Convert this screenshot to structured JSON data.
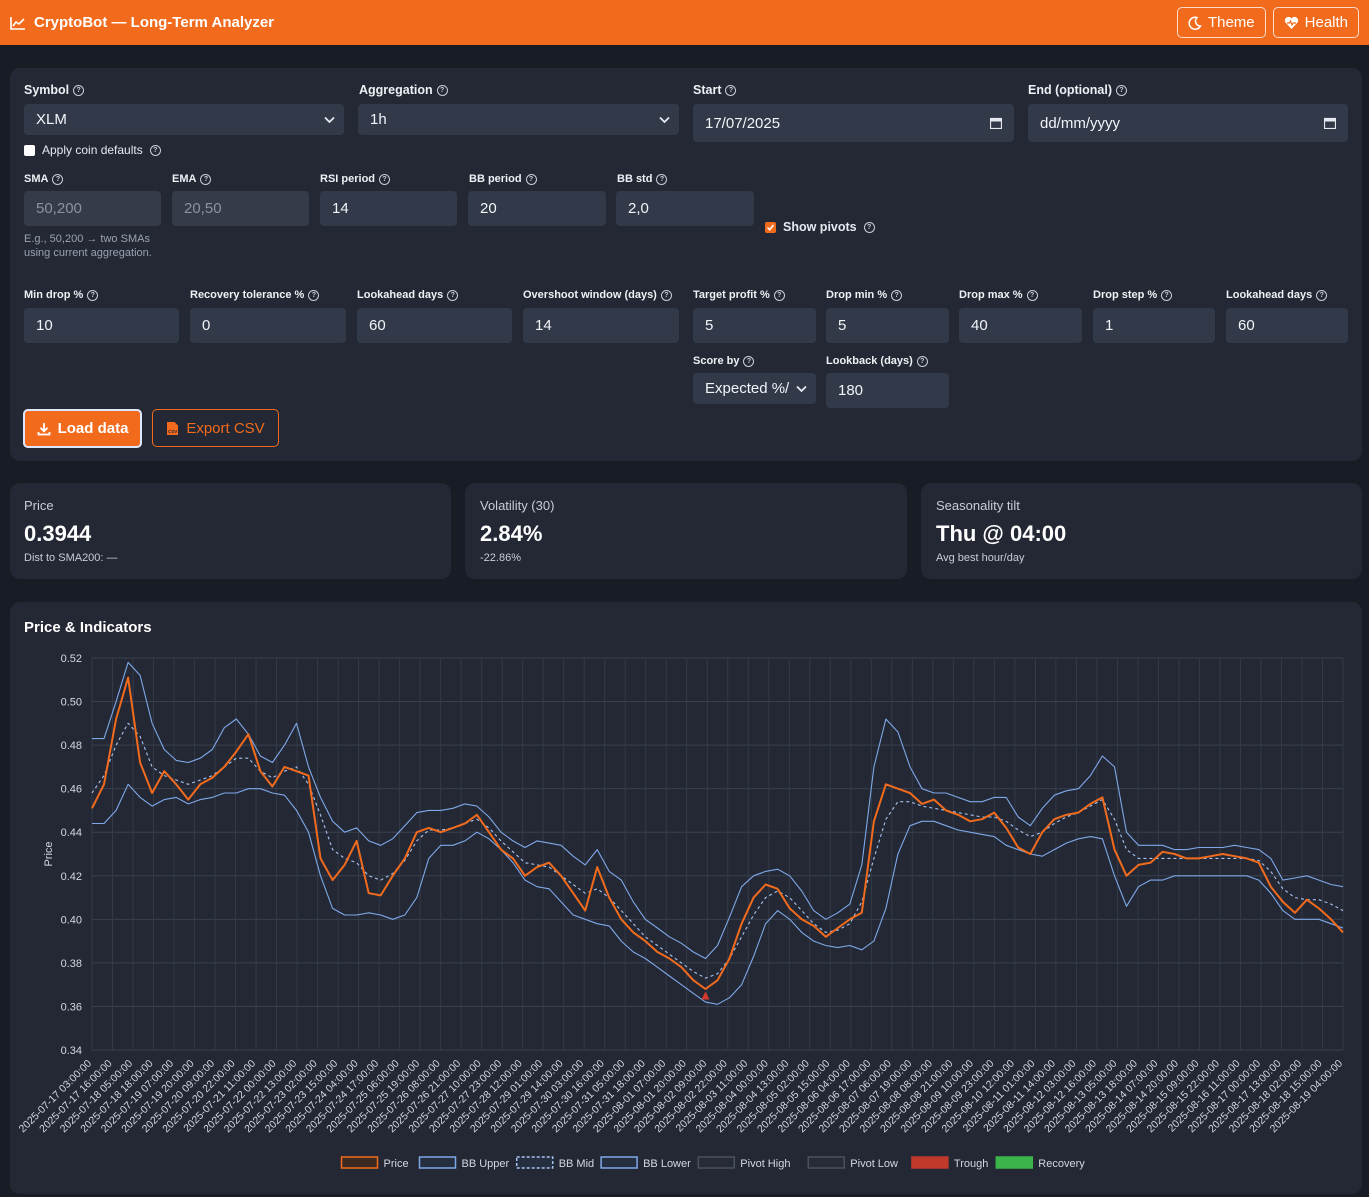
{
  "app": {
    "title": "CryptoBot — Long-Term Analyzer",
    "theme_label": "Theme",
    "health_label": "Health",
    "accent": "#f26b1d"
  },
  "controls": {
    "symbol": {
      "label": "Symbol",
      "value": "XLM"
    },
    "aggregation": {
      "label": "Aggregation",
      "value": "1h"
    },
    "start": {
      "label": "Start",
      "value": "17/07/2025"
    },
    "end": {
      "label": "End (optional)",
      "value": "dd/mm/yyyy"
    },
    "apply_defaults": {
      "label": "Apply coin defaults",
      "checked": false
    },
    "sma": {
      "label": "SMA",
      "value": "50,200",
      "hint": "E.g., 50,200 → two SMAs using current aggregation."
    },
    "ema": {
      "label": "EMA",
      "value": "20,50"
    },
    "rsi": {
      "label": "RSI period",
      "value": "14"
    },
    "bb_period": {
      "label": "BB period",
      "value": "20"
    },
    "bb_std": {
      "label": "BB std",
      "value": "2,0"
    },
    "show_pivots": {
      "label": "Show pivots",
      "checked": true
    },
    "min_drop": {
      "label": "Min drop %",
      "value": "10"
    },
    "recovery_tol": {
      "label": "Recovery tolerance %",
      "value": "0"
    },
    "lookahead_left": {
      "label": "Lookahead days",
      "value": "60"
    },
    "overshoot": {
      "label": "Overshoot window (days)",
      "value": "14"
    },
    "target_profit": {
      "label": "Target profit %",
      "value": "5"
    },
    "drop_min": {
      "label": "Drop min %",
      "value": "5"
    },
    "drop_max": {
      "label": "Drop max %",
      "value": "40"
    },
    "drop_step": {
      "label": "Drop step %",
      "value": "1"
    },
    "lookahead_right": {
      "label": "Lookahead days",
      "value": "60"
    },
    "score_by": {
      "label": "Score by",
      "value": "Expected %/"
    },
    "lookback": {
      "label": "Lookback (days)",
      "value": "180"
    },
    "load_label": "Load data",
    "export_label": "Export CSV"
  },
  "stats": [
    {
      "label": "Price",
      "value": "0.3944",
      "sub": "Dist to SMA200: —"
    },
    {
      "label": "Volatility (30)",
      "value": "2.84%",
      "sub": "-22.86%"
    },
    {
      "label": "Seasonality tilt",
      "value": "Thu @ 04:00",
      "sub": "Avg best hour/day"
    }
  ],
  "chart_panel_title": "Price & Indicators",
  "chart_data": {
    "type": "line",
    "ylabel": "Price",
    "ylim": [
      0.34,
      0.52
    ],
    "yticks": [
      "0.34",
      "0.36",
      "0.38",
      "0.40",
      "0.42",
      "0.44",
      "0.46",
      "0.48",
      "0.50",
      "0.52"
    ],
    "grid": true,
    "legend_position": "bottom",
    "x_tick_labels": [
      "2025-07-17 03:00:00",
      "2025-07-17 16:00:00",
      "2025-07-18 05:00:00",
      "2025-07-18 18:00:00",
      "2025-07-19 07:00:00",
      "2025-07-19 20:00:00",
      "2025-07-20 09:00:00",
      "2025-07-20 22:00:00",
      "2025-07-21 11:00:00",
      "2025-07-22 00:00:00",
      "2025-07-22 13:00:00",
      "2025-07-23 02:00:00",
      "2025-07-23 15:00:00",
      "2025-07-24 04:00:00",
      "2025-07-24 17:00:00",
      "2025-07-25 06:00:00",
      "2025-07-25 19:00:00",
      "2025-07-26 08:00:00",
      "2025-07-26 21:00:00",
      "2025-07-27 10:00:00",
      "2025-07-27 23:00:00",
      "2025-07-28 12:00:00",
      "2025-07-29 01:00:00",
      "2025-07-29 14:00:00",
      "2025-07-30 03:00:00",
      "2025-07-30 16:00:00",
      "2025-07-31 05:00:00",
      "2025-07-31 18:00:00",
      "2025-08-01 07:00:00",
      "2025-08-01 20:00:00",
      "2025-08-02 09:00:00",
      "2025-08-02 22:00:00",
      "2025-08-03 11:00:00",
      "2025-08-04 00:00:00",
      "2025-08-04 13:00:00",
      "2025-08-05 02:00:00",
      "2025-08-05 15:00:00",
      "2025-08-06 04:00:00",
      "2025-08-06 17:00:00",
      "2025-08-07 06:00:00",
      "2025-08-07 19:00:00",
      "2025-08-08 08:00:00",
      "2025-08-08 21:00:00",
      "2025-08-09 10:00:00",
      "2025-08-09 23:00:00",
      "2025-08-10 12:00:00",
      "2025-08-11 01:00:00",
      "2025-08-11 14:00:00",
      "2025-08-12 03:00:00",
      "2025-08-12 16:00:00",
      "2025-08-13 05:00:00",
      "2025-08-13 18:00:00",
      "2025-08-14 07:00:00",
      "2025-08-14 20:00:00",
      "2025-08-15 09:00:00",
      "2025-08-15 22:00:00",
      "2025-08-16 11:00:00",
      "2025-08-17 00:00:00",
      "2025-08-17 13:00:00",
      "2025-08-18 02:00:00",
      "2025-08-18 15:00:00",
      "2025-08-19 04:00:00"
    ],
    "series": [
      {
        "name": "Price",
        "color": "#f26b1d",
        "style": "solid",
        "values": [
          0.451,
          0.462,
          0.492,
          0.511,
          0.472,
          0.458,
          0.468,
          0.462,
          0.455,
          0.462,
          0.465,
          0.47,
          0.477,
          0.485,
          0.468,
          0.461,
          0.47,
          0.468,
          0.466,
          0.428,
          0.418,
          0.425,
          0.436,
          0.412,
          0.411,
          0.42,
          0.428,
          0.44,
          0.442,
          0.44,
          0.442,
          0.444,
          0.448,
          0.44,
          0.432,
          0.428,
          0.42,
          0.424,
          0.426,
          0.42,
          0.412,
          0.404,
          0.424,
          0.41,
          0.4,
          0.394,
          0.39,
          0.385,
          0.382,
          0.378,
          0.372,
          0.368,
          0.372,
          0.382,
          0.398,
          0.41,
          0.416,
          0.414,
          0.405,
          0.4,
          0.397,
          0.392,
          0.396,
          0.4,
          0.403,
          0.445,
          0.462,
          0.46,
          0.458,
          0.453,
          0.455,
          0.45,
          0.448,
          0.445,
          0.446,
          0.449,
          0.442,
          0.433,
          0.43,
          0.44,
          0.446,
          0.448,
          0.449,
          0.453,
          0.456,
          0.432,
          0.42,
          0.425,
          0.426,
          0.431,
          0.43,
          0.428,
          0.428,
          0.429,
          0.43,
          0.429,
          0.428,
          0.426,
          0.415,
          0.408,
          0.403,
          0.409,
          0.405,
          0.4,
          0.394
        ]
      },
      {
        "name": "BB Upper",
        "color": "#7fa8e8",
        "style": "solid",
        "values": [
          0.483,
          0.483,
          0.5,
          0.518,
          0.512,
          0.49,
          0.478,
          0.473,
          0.472,
          0.474,
          0.478,
          0.488,
          0.492,
          0.485,
          0.475,
          0.472,
          0.48,
          0.49,
          0.47,
          0.456,
          0.445,
          0.44,
          0.442,
          0.436,
          0.434,
          0.437,
          0.443,
          0.449,
          0.45,
          0.45,
          0.451,
          0.453,
          0.452,
          0.447,
          0.44,
          0.436,
          0.433,
          0.436,
          0.435,
          0.434,
          0.429,
          0.425,
          0.432,
          0.422,
          0.418,
          0.408,
          0.4,
          0.396,
          0.392,
          0.389,
          0.385,
          0.382,
          0.388,
          0.401,
          0.415,
          0.42,
          0.422,
          0.423,
          0.42,
          0.413,
          0.404,
          0.4,
          0.403,
          0.407,
          0.425,
          0.47,
          0.492,
          0.486,
          0.47,
          0.46,
          0.458,
          0.458,
          0.456,
          0.454,
          0.454,
          0.456,
          0.456,
          0.447,
          0.443,
          0.451,
          0.457,
          0.459,
          0.46,
          0.466,
          0.475,
          0.47,
          0.44,
          0.434,
          0.434,
          0.434,
          0.432,
          0.432,
          0.433,
          0.433,
          0.433,
          0.434,
          0.433,
          0.432,
          0.428,
          0.418,
          0.419,
          0.42,
          0.418,
          0.416,
          0.415
        ]
      },
      {
        "name": "BB Mid",
        "color": "#a9c3f0",
        "style": "dashed",
        "values": [
          0.458,
          0.466,
          0.48,
          0.49,
          0.484,
          0.47,
          0.466,
          0.464,
          0.462,
          0.464,
          0.466,
          0.47,
          0.474,
          0.474,
          0.468,
          0.465,
          0.468,
          0.47,
          0.462,
          0.448,
          0.432,
          0.428,
          0.426,
          0.42,
          0.418,
          0.421,
          0.427,
          0.436,
          0.441,
          0.441,
          0.442,
          0.444,
          0.446,
          0.442,
          0.436,
          0.431,
          0.426,
          0.425,
          0.424,
          0.42,
          0.416,
          0.412,
          0.414,
          0.41,
          0.404,
          0.398,
          0.392,
          0.388,
          0.384,
          0.38,
          0.376,
          0.373,
          0.375,
          0.382,
          0.392,
          0.402,
          0.41,
          0.413,
          0.41,
          0.404,
          0.398,
          0.394,
          0.395,
          0.398,
          0.408,
          0.428,
          0.446,
          0.454,
          0.454,
          0.452,
          0.451,
          0.45,
          0.449,
          0.448,
          0.447,
          0.447,
          0.445,
          0.441,
          0.438,
          0.44,
          0.444,
          0.447,
          0.449,
          0.452,
          0.455,
          0.446,
          0.432,
          0.428,
          0.428,
          0.428,
          0.428,
          0.428,
          0.428,
          0.428,
          0.428,
          0.428,
          0.428,
          0.427,
          0.422,
          0.414,
          0.41,
          0.409,
          0.409,
          0.407,
          0.404
        ]
      },
      {
        "name": "BB Lower",
        "color": "#7fa8e8",
        "style": "solid",
        "values": [
          0.444,
          0.444,
          0.45,
          0.462,
          0.456,
          0.452,
          0.455,
          0.456,
          0.453,
          0.455,
          0.456,
          0.458,
          0.458,
          0.46,
          0.46,
          0.458,
          0.457,
          0.45,
          0.44,
          0.42,
          0.405,
          0.402,
          0.402,
          0.403,
          0.402,
          0.4,
          0.402,
          0.41,
          0.428,
          0.434,
          0.434,
          0.436,
          0.44,
          0.437,
          0.432,
          0.426,
          0.418,
          0.415,
          0.414,
          0.408,
          0.402,
          0.4,
          0.398,
          0.397,
          0.39,
          0.385,
          0.382,
          0.378,
          0.374,
          0.37,
          0.366,
          0.362,
          0.361,
          0.364,
          0.37,
          0.383,
          0.398,
          0.404,
          0.4,
          0.394,
          0.39,
          0.388,
          0.387,
          0.388,
          0.386,
          0.39,
          0.405,
          0.43,
          0.443,
          0.445,
          0.445,
          0.443,
          0.441,
          0.44,
          0.439,
          0.438,
          0.434,
          0.432,
          0.43,
          0.429,
          0.432,
          0.435,
          0.437,
          0.438,
          0.437,
          0.42,
          0.406,
          0.415,
          0.418,
          0.418,
          0.42,
          0.42,
          0.42,
          0.42,
          0.42,
          0.42,
          0.42,
          0.418,
          0.412,
          0.404,
          0.4,
          0.4,
          0.4,
          0.398,
          0.396
        ]
      }
    ],
    "legend": [
      {
        "name": "Price",
        "fill": "#3a2a22",
        "stroke": "#f26b1d",
        "dash": false
      },
      {
        "name": "BB Upper",
        "fill": "#262f40",
        "stroke": "#7fa8e8",
        "dash": false
      },
      {
        "name": "BB Mid",
        "fill": "#262f40",
        "stroke": "#a9c3f0",
        "dash": true
      },
      {
        "name": "BB Lower",
        "fill": "#262f40",
        "stroke": "#7fa8e8",
        "dash": false
      },
      {
        "name": "Pivot High",
        "fill": "#262b35",
        "stroke": "#4a5060",
        "dash": false
      },
      {
        "name": "Pivot Low",
        "fill": "#262b35",
        "stroke": "#4a5060",
        "dash": false
      },
      {
        "name": "Trough",
        "fill": "#c0392b",
        "stroke": "#c0392b",
        "dash": false
      },
      {
        "name": "Recovery",
        "fill": "#3cb44b",
        "stroke": "#3cb44b",
        "dash": false
      }
    ],
    "trough_markers": [
      {
        "x_index": 51,
        "y": 0.365
      }
    ]
  }
}
